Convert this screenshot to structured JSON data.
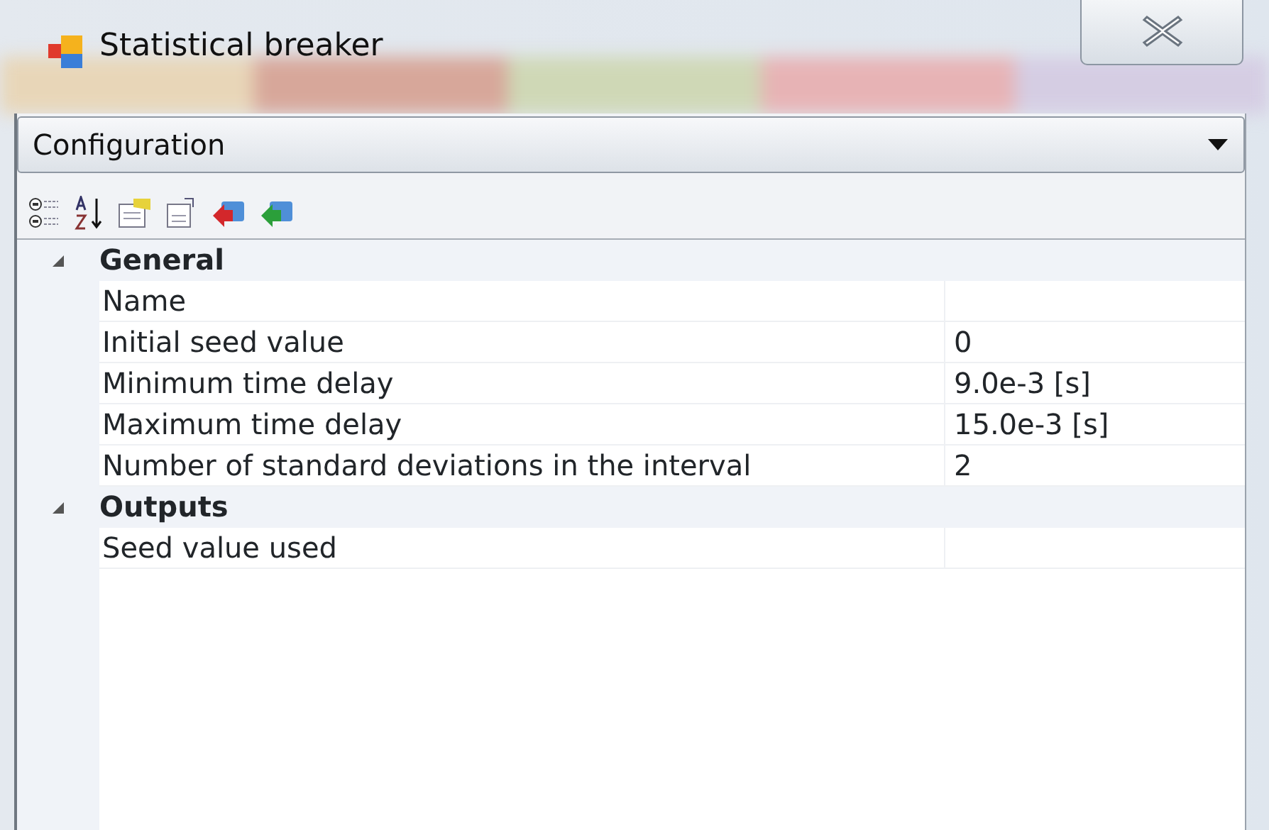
{
  "window": {
    "title": "Statistical breaker"
  },
  "dropdown": {
    "value": "Configuration"
  },
  "categories": [
    {
      "label": "General",
      "expanded": true,
      "properties": [
        {
          "name": "Name"
        },
        {
          "name": "Initial seed value",
          "value": "0"
        },
        {
          "name": "Minimum time delay",
          "value": "9.0e-3 [s]"
        },
        {
          "name": "Maximum time delay",
          "value": "15.0e-3 [s]"
        },
        {
          "name": "Number of standard deviations in the interval",
          "value": "2"
        }
      ]
    },
    {
      "label": "Outputs",
      "expanded": true,
      "properties": [
        {
          "name": "Seed value used"
        }
      ]
    }
  ]
}
